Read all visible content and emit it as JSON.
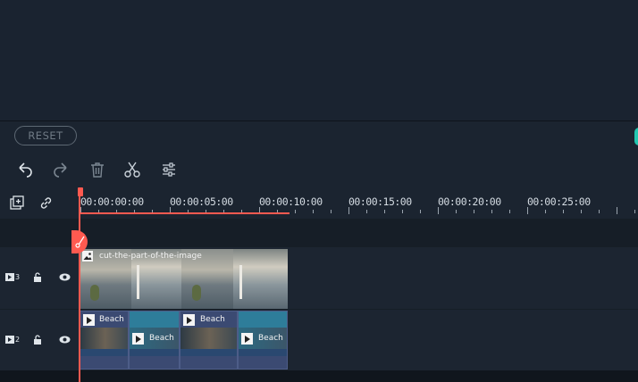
{
  "reset": {
    "label": "RESET"
  },
  "toolbar": {
    "undo": "undo-icon",
    "redo": "redo-icon",
    "delete": "trash-icon",
    "split": "scissors-icon",
    "adjust": "sliders-icon"
  },
  "timeline": {
    "ticks": [
      "00:00:00:00",
      "00:00:05:00",
      "00:00:10:00",
      "00:00:15:00",
      "00:00:20:00",
      "00:00:25:00"
    ],
    "tracks": [
      {
        "number": "3",
        "clip_title": "cut-the-part-of-the-image"
      },
      {
        "number": "2",
        "clips": [
          "Beach",
          "Beach",
          "Beach",
          "Beach"
        ]
      }
    ]
  },
  "colors": {
    "background": "#161e27",
    "playhead": "#ff5a50",
    "accent": "#23c7b0",
    "clip_blue": "#2e7d9a"
  }
}
